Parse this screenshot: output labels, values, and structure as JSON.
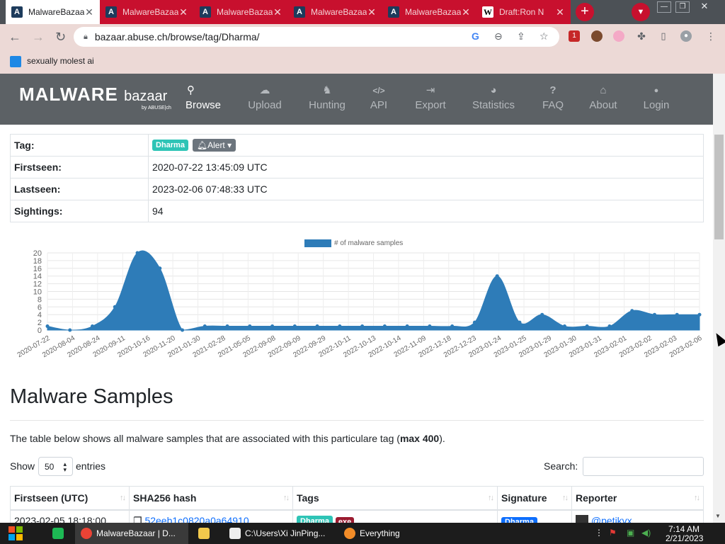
{
  "browser": {
    "tabs": [
      {
        "title": "MalwareBazaar",
        "favicon": "A",
        "active": true
      },
      {
        "title": "MalwareBazaar",
        "favicon": "A",
        "active": false
      },
      {
        "title": "MalwareBazaar",
        "favicon": "A",
        "active": false
      },
      {
        "title": "MalwareBazaar",
        "favicon": "A",
        "active": false
      },
      {
        "title": "MalwareBazaar",
        "favicon": "A",
        "active": false
      },
      {
        "title": "Draft:Ron N",
        "favicon": "W",
        "active": false
      }
    ],
    "new_tab": "+",
    "url": "bazaar.abuse.ch/browse/tag/Dharma/",
    "bookmark": "sexually molest ai",
    "extension_badge": "1",
    "colors": {
      "tab_strip": "#4c5156",
      "inactive_tab": "#c8102e",
      "toolbar": "#ecd9d6"
    }
  },
  "site": {
    "logo": "MALWARE",
    "logo_sub": "bazaar",
    "logo_by": "by ABUSE|ch",
    "nav": [
      {
        "label": "Browse",
        "icon": "search-icon",
        "glyph": "⚲",
        "active": true
      },
      {
        "label": "Upload",
        "icon": "cloud-upload-icon",
        "glyph": "☁",
        "active": false
      },
      {
        "label": "Hunting",
        "icon": "hunting-icon",
        "glyph": "♞",
        "active": false
      },
      {
        "label": "API",
        "icon": "code-icon",
        "glyph": "</>",
        "active": false
      },
      {
        "label": "Export",
        "icon": "export-icon",
        "glyph": "⇥",
        "active": false
      },
      {
        "label": "Statistics",
        "icon": "pie-chart-icon",
        "glyph": "◕",
        "active": false
      },
      {
        "label": "FAQ",
        "icon": "question-icon",
        "glyph": "?",
        "active": false
      },
      {
        "label": "About",
        "icon": "building-icon",
        "glyph": "⌂",
        "active": false
      },
      {
        "label": "Login",
        "icon": "user-icon",
        "glyph": "●",
        "active": false
      }
    ],
    "colors": {
      "header_bg": "#5c6165",
      "tag_badge": "#2ec4b6",
      "alert_button": "#6c757d"
    }
  },
  "tag_info": {
    "tag_label": "Tag:",
    "tag_value": "Dharma",
    "alert_label": "Alert",
    "firstseen_label": "Firstseen:",
    "firstseen_value": "2020-07-22 13:45:09 UTC",
    "lastseen_label": "Lastseen:",
    "lastseen_value": "2023-02-06 07:48:33 UTC",
    "sightings_label": "Sightings:",
    "sightings_value": "94"
  },
  "chart_data": {
    "type": "area",
    "series": [
      {
        "name": "# of malware samples",
        "color": "#2e7cb8",
        "values": [
          1,
          0,
          1,
          6,
          20,
          16,
          0,
          1,
          1,
          1,
          1,
          1,
          1,
          1,
          1,
          1,
          1,
          1,
          1,
          2,
          14,
          2,
          4,
          1,
          1,
          1,
          5,
          4,
          4,
          4
        ]
      }
    ],
    "categories": [
      "2020-07-22",
      "2020-08-04",
      "2020-08-24",
      "2020-09-11",
      "2020-10-16",
      "2020-11-20",
      "2021-01-30",
      "2021-02-28",
      "2021-05-05",
      "2022-09-08",
      "2022-09-09",
      "2022-09-29",
      "2022-10-11",
      "2022-10-13",
      "2022-10-14",
      "2022-11-09",
      "2022-12-18",
      "2022-12-23",
      "2023-01-24",
      "2023-01-25",
      "2023-01-29",
      "2023-01-30",
      "2023-01-31",
      "2023-02-01",
      "2023-02-02",
      "2023-02-03",
      "2023-02-06"
    ],
    "category_index": [
      0,
      1,
      2,
      3,
      4,
      5,
      6,
      7,
      8,
      9,
      10,
      11,
      12,
      13,
      14,
      15,
      16,
      17,
      18,
      19,
      20,
      21,
      22,
      23,
      24,
      25,
      26
    ],
    "y_ticks": [
      0,
      2,
      4,
      6,
      8,
      10,
      12,
      14,
      16,
      18,
      20
    ],
    "ylim": [
      0,
      20
    ],
    "grid": true,
    "legend_position": "top-center"
  },
  "samples": {
    "title": "Malware Samples",
    "desc_prefix": "The table below shows all malware samples that are associated with this particulare tag (",
    "desc_bold": "max 400",
    "desc_suffix": ").",
    "show_label": "Show",
    "page_size": "50",
    "entries_label": "entries",
    "search_label": "Search:",
    "search_value": "",
    "columns": [
      "Firstseen (UTC)",
      "SHA256 hash",
      "Tags",
      "Signature",
      "Reporter"
    ],
    "rows": [
      {
        "firstseen": "2023-02-05 18:18:00",
        "hash": "52eeb1c0820a0a64910",
        "tags": [
          "Dharma",
          "exe"
        ],
        "signature": "Dharma",
        "reporter": "@petikvx"
      }
    ]
  },
  "taskbar": {
    "items": [
      {
        "label": "MalwareBazaar | D...",
        "icon": "chrome-icon",
        "active": true
      },
      {
        "label": "",
        "icon": "folder-icon",
        "active": false
      },
      {
        "label": "C:\\Users\\Xi JinPing...",
        "icon": "terminal-icon",
        "active": false
      },
      {
        "label": "Everything",
        "icon": "search-app-icon",
        "active": false
      }
    ],
    "time": "7:14 AM",
    "date": "2/21/2023"
  }
}
